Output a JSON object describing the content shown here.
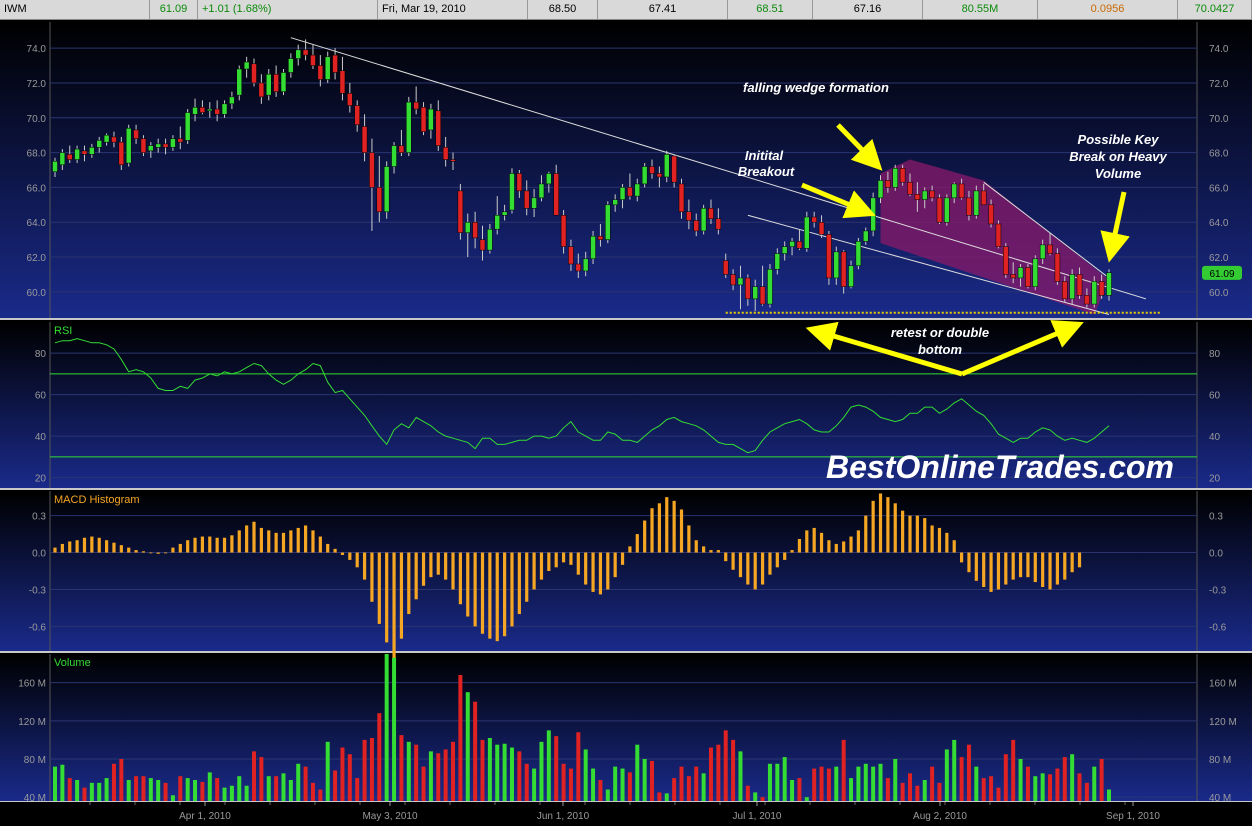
{
  "header": {
    "symbol": "IWM",
    "last": "61.09",
    "change": "+1.01 (1.68%)",
    "date": "Fri, Mar 19, 2010",
    "open": "68.50",
    "low": "67.41",
    "high": "68.51",
    "prev": "67.16",
    "volume": "80.55M",
    "indicator": "0.0956",
    "value2": "70.0427"
  },
  "colors": {
    "up": "#33dd33",
    "down": "#e02222",
    "grid": "#2a3570",
    "axis": "#9a9a9a",
    "panel_top": "#000000",
    "panel_bottom": "#1a2a8a",
    "rsi_line": "#33dd33",
    "macd_bar": "#f5a623",
    "volume_label": "#33dd33",
    "annotation_arrow": "#ffff00",
    "wedge_fill": "#8a1a6a"
  },
  "chart_data": {
    "type": "bar",
    "title": "",
    "x_ticks": [
      "Apr 1, 2010",
      "May 3, 2010",
      "Jun 1, 2010",
      "Jul 1, 2010",
      "Aug 2, 2010",
      "Sep 1, 2010"
    ],
    "price": {
      "type": "candlestick",
      "ylim": [
        58.5,
        75.5
      ],
      "y_ticks": [
        "74.0",
        "72.0",
        "70.0",
        "68.0",
        "66.0",
        "64.0",
        "62.0",
        "60.0"
      ],
      "last_price_tag": "61.09",
      "ohlc": [
        [
          66.9,
          67.7,
          66.6,
          67.5
        ],
        [
          67.3,
          68.2,
          67.0,
          68.0
        ],
        [
          67.9,
          68.4,
          67.4,
          67.6
        ],
        [
          67.6,
          68.4,
          67.4,
          68.2
        ],
        [
          68.1,
          68.4,
          67.5,
          67.9
        ],
        [
          67.9,
          68.5,
          67.7,
          68.3
        ],
        [
          68.3,
          68.9,
          68.0,
          68.7
        ],
        [
          68.6,
          69.1,
          68.4,
          69.0
        ],
        [
          68.9,
          69.2,
          68.3,
          68.6
        ],
        [
          68.6,
          68.9,
          67.0,
          67.3
        ],
        [
          67.4,
          69.6,
          67.2,
          69.4
        ],
        [
          69.3,
          69.6,
          68.5,
          68.8
        ],
        [
          68.8,
          69.0,
          67.8,
          68.0
        ],
        [
          68.1,
          68.6,
          67.7,
          68.4
        ],
        [
          68.3,
          68.8,
          68.0,
          68.5
        ],
        [
          68.5,
          68.8,
          67.9,
          68.3
        ],
        [
          68.3,
          69.0,
          68.1,
          68.8
        ],
        [
          68.8,
          69.5,
          68.2,
          68.6
        ],
        [
          68.7,
          70.5,
          68.5,
          70.3
        ],
        [
          70.2,
          71.1,
          69.8,
          70.6
        ],
        [
          70.6,
          71.0,
          70.2,
          70.3
        ],
        [
          70.4,
          70.9,
          70.0,
          70.5
        ],
        [
          70.5,
          71.0,
          69.8,
          70.2
        ],
        [
          70.2,
          71.0,
          70.0,
          70.8
        ],
        [
          70.8,
          71.5,
          70.5,
          71.2
        ],
        [
          71.3,
          73.0,
          71.0,
          72.8
        ],
        [
          72.8,
          73.5,
          72.3,
          73.2
        ],
        [
          73.1,
          73.4,
          71.8,
          72.0
        ],
        [
          72.0,
          72.5,
          70.8,
          71.2
        ],
        [
          71.3,
          72.8,
          71.0,
          72.5
        ],
        [
          72.5,
          73.0,
          71.2,
          71.5
        ],
        [
          71.5,
          72.8,
          71.3,
          72.6
        ],
        [
          72.6,
          73.7,
          72.3,
          73.4
        ],
        [
          73.4,
          74.2,
          73.0,
          73.9
        ],
        [
          73.9,
          74.5,
          73.3,
          73.6
        ],
        [
          73.6,
          74.2,
          72.8,
          73.0
        ],
        [
          73.0,
          73.6,
          71.8,
          72.2
        ],
        [
          72.2,
          73.8,
          72.0,
          73.5
        ],
        [
          73.6,
          74.0,
          72.2,
          72.6
        ],
        [
          72.7,
          73.5,
          71.0,
          71.4
        ],
        [
          71.4,
          72.0,
          70.3,
          70.7
        ],
        [
          70.7,
          71.0,
          69.2,
          69.6
        ],
        [
          69.5,
          70.2,
          67.5,
          68.0
        ],
        [
          68.0,
          68.8,
          63.5,
          66.0
        ],
        [
          66.0,
          67.8,
          64.0,
          64.6
        ],
        [
          64.6,
          67.5,
          64.2,
          67.2
        ],
        [
          67.2,
          68.6,
          66.8,
          68.4
        ],
        [
          68.4,
          69.3,
          67.8,
          68.0
        ],
        [
          68.0,
          71.2,
          67.8,
          70.9
        ],
        [
          70.9,
          71.8,
          70.2,
          70.5
        ],
        [
          70.6,
          70.9,
          69.0,
          69.2
        ],
        [
          69.3,
          70.8,
          68.8,
          70.5
        ],
        [
          70.4,
          71.0,
          68.1,
          68.4
        ],
        [
          68.3,
          68.9,
          67.2,
          67.6
        ],
        [
          67.6,
          68.0,
          67.0,
          67.5
        ],
        [
          65.8,
          66.2,
          63.0,
          63.4
        ],
        [
          63.4,
          64.5,
          62.0,
          64.0
        ],
        [
          64.0,
          64.6,
          62.5,
          63.1
        ],
        [
          63.0,
          63.8,
          61.8,
          62.4
        ],
        [
          62.4,
          63.9,
          62.2,
          63.6
        ],
        [
          63.6,
          65.5,
          63.3,
          64.4
        ],
        [
          64.4,
          65.0,
          64.1,
          64.6
        ],
        [
          64.7,
          67.1,
          64.5,
          66.8
        ],
        [
          66.8,
          67.0,
          65.4,
          65.8
        ],
        [
          65.8,
          66.4,
          64.4,
          64.8
        ],
        [
          64.8,
          65.9,
          64.3,
          65.4
        ],
        [
          65.4,
          66.7,
          65.2,
          66.2
        ],
        [
          66.2,
          66.9,
          65.7,
          66.8
        ],
        [
          66.8,
          67.3,
          65.4,
          64.4
        ],
        [
          64.4,
          64.7,
          62.2,
          62.6
        ],
        [
          62.6,
          63.0,
          61.2,
          61.6
        ],
        [
          61.6,
          62.2,
          60.8,
          61.2
        ],
        [
          61.2,
          62.3,
          60.9,
          61.9
        ],
        [
          61.9,
          63.5,
          61.6,
          63.2
        ],
        [
          63.2,
          63.9,
          62.6,
          63.0
        ],
        [
          63.0,
          65.2,
          62.8,
          65.0
        ],
        [
          65.0,
          65.6,
          64.6,
          65.3
        ],
        [
          65.3,
          66.2,
          64.8,
          66.0
        ],
        [
          66.0,
          66.8,
          65.3,
          65.5
        ],
        [
          65.5,
          66.5,
          65.2,
          66.2
        ],
        [
          66.2,
          67.4,
          66.0,
          67.2
        ],
        [
          67.2,
          67.6,
          66.5,
          66.8
        ],
        [
          66.8,
          67.2,
          66.0,
          66.6
        ],
        [
          66.6,
          68.1,
          66.3,
          67.9
        ],
        [
          67.8,
          67.9,
          66.0,
          66.3
        ],
        [
          66.2,
          66.5,
          64.2,
          64.6
        ],
        [
          64.6,
          65.3,
          63.6,
          64.1
        ],
        [
          64.1,
          64.5,
          63.2,
          63.5
        ],
        [
          63.5,
          65.0,
          63.3,
          64.8
        ],
        [
          64.8,
          65.3,
          63.9,
          64.2
        ],
        [
          64.2,
          64.8,
          63.3,
          63.6
        ],
        [
          61.8,
          62.2,
          60.8,
          61.0
        ],
        [
          61.0,
          61.3,
          60.1,
          60.4
        ],
        [
          60.4,
          61.5,
          59.0,
          60.8
        ],
        [
          60.8,
          61.0,
          59.2,
          59.6
        ],
        [
          59.6,
          60.7,
          58.9,
          60.3
        ],
        [
          60.3,
          61.5,
          59.2,
          59.3
        ],
        [
          59.3,
          61.6,
          59.1,
          61.3
        ],
        [
          61.3,
          62.5,
          61.0,
          62.2
        ],
        [
          62.2,
          62.9,
          61.8,
          62.6
        ],
        [
          62.6,
          63.1,
          62.1,
          62.9
        ],
        [
          62.9,
          63.6,
          62.4,
          62.5
        ],
        [
          62.5,
          64.6,
          62.3,
          64.3
        ],
        [
          64.3,
          64.6,
          63.7,
          64.0
        ],
        [
          64.0,
          64.4,
          63.1,
          63.3
        ],
        [
          63.3,
          63.5,
          60.4,
          60.8
        ],
        [
          60.8,
          62.6,
          60.4,
          62.3
        ],
        [
          62.3,
          62.4,
          59.9,
          60.3
        ],
        [
          60.3,
          61.8,
          60.2,
          61.5
        ],
        [
          61.5,
          63.1,
          61.3,
          62.9
        ],
        [
          62.9,
          63.7,
          62.7,
          63.5
        ],
        [
          63.5,
          65.7,
          63.2,
          65.4
        ],
        [
          65.4,
          66.7,
          65.1,
          66.4
        ],
        [
          66.4,
          66.9,
          65.7,
          66.0
        ],
        [
          66.0,
          67.3,
          65.8,
          67.1
        ],
        [
          67.1,
          67.3,
          66.1,
          66.3
        ],
        [
          66.3,
          66.8,
          65.5,
          65.6
        ],
        [
          65.6,
          66.3,
          64.6,
          65.3
        ],
        [
          65.3,
          66.0,
          64.8,
          65.8
        ],
        [
          65.8,
          66.1,
          65.2,
          65.4
        ],
        [
          65.4,
          65.6,
          63.9,
          64.0
        ],
        [
          64.0,
          65.6,
          63.8,
          65.4
        ],
        [
          65.4,
          66.3,
          65.1,
          66.2
        ],
        [
          66.2,
          66.5,
          65.3,
          65.4
        ],
        [
          65.4,
          65.8,
          64.1,
          64.4
        ],
        [
          64.4,
          66.1,
          64.2,
          65.8
        ],
        [
          65.8,
          66.2,
          65.0,
          65.0
        ],
        [
          65.0,
          65.3,
          63.7,
          63.9
        ],
        [
          63.9,
          64.1,
          62.5,
          62.6
        ],
        [
          62.6,
          62.8,
          60.8,
          61.0
        ],
        [
          61.0,
          61.7,
          60.5,
          60.8
        ],
        [
          60.8,
          61.6,
          60.3,
          61.4
        ],
        [
          61.4,
          61.6,
          60.2,
          60.3
        ],
        [
          60.3,
          62.1,
          60.1,
          61.9
        ],
        [
          61.9,
          63.0,
          61.6,
          62.7
        ],
        [
          62.7,
          63.4,
          62.1,
          62.2
        ],
        [
          62.2,
          62.5,
          60.4,
          60.6
        ],
        [
          60.6,
          60.9,
          59.4,
          59.6
        ],
        [
          59.6,
          61.3,
          59.3,
          61.0
        ],
        [
          61.0,
          61.4,
          59.6,
          59.8
        ],
        [
          59.8,
          60.2,
          59.1,
          59.3
        ],
        [
          59.3,
          60.9,
          59.1,
          60.6
        ],
        [
          60.6,
          61.0,
          59.6,
          59.8
        ],
        [
          59.8,
          61.3,
          59.5,
          61.1
        ]
      ]
    },
    "rsi": {
      "label": "RSI",
      "ylim": [
        15,
        95
      ],
      "y_ticks": [
        "80",
        "60",
        "40",
        "20"
      ],
      "overbought": 70,
      "oversold": 30,
      "values": [
        85,
        86,
        86,
        87,
        86,
        85,
        85,
        84,
        82,
        77,
        71,
        72,
        71,
        68,
        63,
        62,
        62,
        64,
        63,
        67,
        68,
        70,
        69,
        71,
        70,
        71,
        73,
        75,
        74,
        70,
        67,
        65,
        67,
        70,
        72,
        75,
        74,
        66,
        61,
        62,
        58,
        54,
        50,
        45,
        40,
        36,
        43,
        46,
        44,
        49,
        47,
        45,
        42,
        40,
        39,
        38,
        37,
        34,
        39,
        39,
        36,
        36,
        37,
        38,
        38,
        40,
        40,
        39,
        40,
        44,
        47,
        42,
        40,
        38,
        38,
        42,
        41,
        38,
        38,
        37,
        40,
        43,
        45,
        48,
        49,
        47,
        46,
        45,
        43,
        40,
        37,
        36,
        36,
        34,
        32,
        33,
        38,
        42,
        44,
        46,
        47,
        48,
        46,
        43,
        42,
        42,
        45,
        49,
        54,
        55,
        54,
        52,
        49,
        48,
        47,
        48,
        51,
        51,
        54,
        54,
        51,
        53,
        56,
        58,
        55,
        52,
        50,
        46,
        41,
        39,
        37,
        39,
        39,
        42,
        44,
        43,
        40,
        38,
        39,
        38,
        37,
        39,
        42,
        45
      ]
    },
    "macd": {
      "label": "MACD Histogram",
      "ylim": [
        -0.8,
        0.5
      ],
      "y_ticks": [
        "0.3",
        "0.0",
        "-0.3",
        "-0.6"
      ],
      "values": [
        0.04,
        0.07,
        0.09,
        0.1,
        0.12,
        0.13,
        0.12,
        0.1,
        0.08,
        0.06,
        0.04,
        0.02,
        0.01,
        0.0,
        -0.01,
        0.0,
        0.04,
        0.07,
        0.1,
        0.12,
        0.13,
        0.13,
        0.12,
        0.12,
        0.14,
        0.18,
        0.22,
        0.25,
        0.2,
        0.18,
        0.16,
        0.16,
        0.18,
        0.2,
        0.22,
        0.18,
        0.13,
        0.07,
        0.03,
        -0.02,
        -0.06,
        -0.12,
        -0.22,
        -0.4,
        -0.58,
        -0.73,
        -0.87,
        -0.7,
        -0.5,
        -0.38,
        -0.27,
        -0.2,
        -0.18,
        -0.22,
        -0.3,
        -0.42,
        -0.52,
        -0.6,
        -0.66,
        -0.7,
        -0.72,
        -0.68,
        -0.6,
        -0.5,
        -0.4,
        -0.3,
        -0.22,
        -0.15,
        -0.12,
        -0.08,
        -0.1,
        -0.18,
        -0.26,
        -0.32,
        -0.34,
        -0.3,
        -0.2,
        -0.1,
        0.05,
        0.15,
        0.26,
        0.36,
        0.4,
        0.45,
        0.42,
        0.35,
        0.22,
        0.1,
        0.05,
        0.02,
        0.02,
        -0.07,
        -0.14,
        -0.2,
        -0.26,
        -0.3,
        -0.26,
        -0.18,
        -0.12,
        -0.06,
        0.02,
        0.11,
        0.18,
        0.2,
        0.16,
        0.1,
        0.07,
        0.09,
        0.13,
        0.18,
        0.3,
        0.42,
        0.48,
        0.45,
        0.4,
        0.34,
        0.3,
        0.3,
        0.28,
        0.22,
        0.2,
        0.16,
        0.1,
        -0.08,
        -0.16,
        -0.23,
        -0.28,
        -0.32,
        -0.3,
        -0.26,
        -0.22,
        -0.2,
        -0.2,
        -0.24,
        -0.28,
        -0.3,
        -0.26,
        -0.22,
        -0.16,
        -0.12
      ]
    },
    "volume": {
      "label": "Volume",
      "ylim": [
        36,
        190
      ],
      "y_ticks": [
        "160 M",
        "120 M",
        "80 M",
        "40 M"
      ],
      "values": [
        72,
        74,
        60,
        58,
        50,
        55,
        55,
        60,
        75,
        80,
        58,
        62,
        62,
        60,
        58,
        55,
        42,
        62,
        60,
        58,
        56,
        66,
        60,
        50,
        52,
        62,
        52,
        88,
        82,
        62,
        62,
        65,
        58,
        75,
        72,
        55,
        48,
        98,
        68,
        92,
        85,
        60,
        100,
        102,
        128,
        190,
        186,
        105,
        98,
        95,
        72,
        88,
        86,
        90,
        98,
        168,
        150,
        140,
        100,
        102,
        95,
        96,
        92,
        88,
        75,
        70,
        98,
        110,
        104,
        75,
        70,
        108,
        90,
        70,
        58,
        48,
        72,
        70,
        66,
        95,
        80,
        78,
        45,
        44,
        60,
        72,
        62,
        72,
        65,
        92,
        95,
        110,
        100,
        88,
        52,
        45,
        40,
        75,
        75,
        82,
        58,
        60,
        40,
        70,
        72,
        70,
        72,
        100,
        60,
        72,
        75,
        72,
        75,
        60,
        80,
        55,
        65,
        52,
        58,
        72,
        55,
        90,
        100,
        82,
        95,
        72,
        60,
        62,
        50,
        85,
        100,
        80,
        72,
        62,
        65,
        64,
        70,
        82,
        85,
        65,
        55,
        72,
        80,
        48
      ]
    }
  },
  "annotations": {
    "wedge": "falling wedge formation",
    "breakout": "Initital Breakout",
    "key_break": "Possible Key Break on Heavy Volume",
    "retest": "retest or double bottom",
    "watermark": "BestOnlineTrades.com"
  }
}
